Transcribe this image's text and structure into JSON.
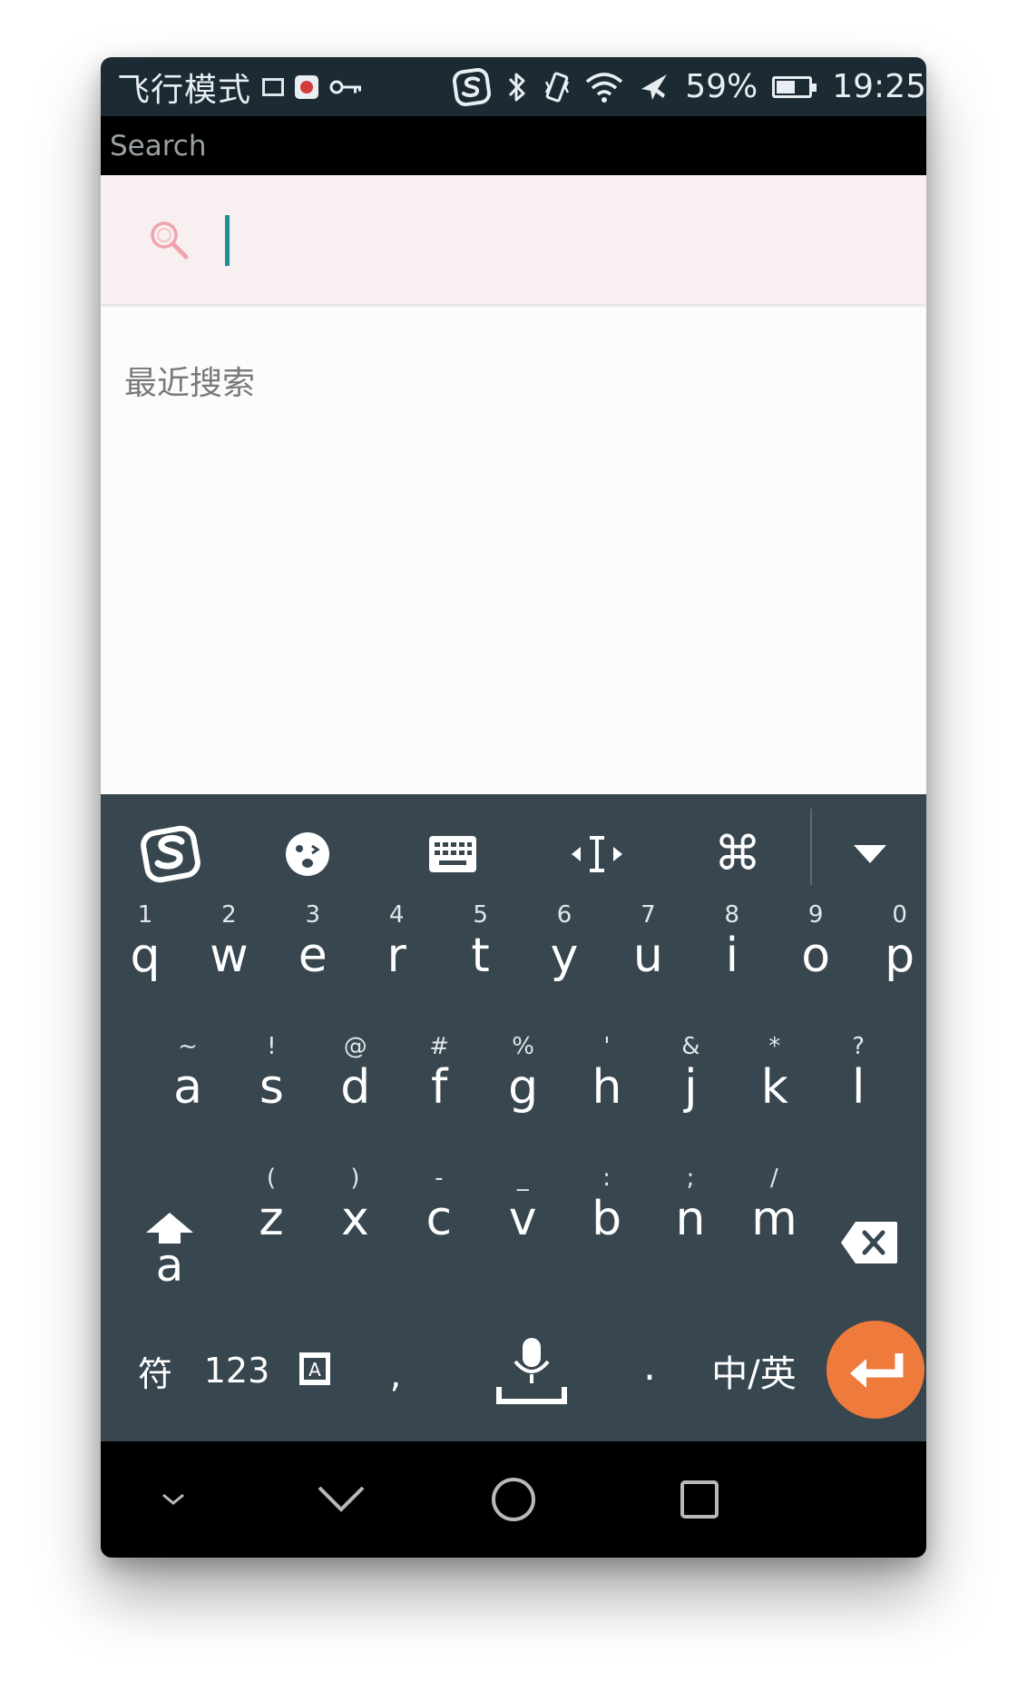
{
  "status_bar": {
    "carrier": "飞行模式",
    "battery_percent": "59%",
    "battery_level": 0.59,
    "time": "19:25",
    "icons": [
      "sim-icon",
      "screen-record-icon",
      "key-icon",
      "sogou-icon",
      "bluetooth-icon",
      "vibrate-icon",
      "wifi-icon",
      "airplane-icon",
      "battery-icon"
    ]
  },
  "title_bar": {
    "title": "Search"
  },
  "search": {
    "value": "",
    "placeholder": ""
  },
  "recent": {
    "title": "最近搜索"
  },
  "keyboard": {
    "toolbar": [
      "sogou-logo-icon",
      "emoji-icon",
      "keyboard-icon",
      "cursor-move-icon",
      "command-icon",
      "collapse-icon"
    ],
    "row1": [
      {
        "pri": "q",
        "sec": "1"
      },
      {
        "pri": "w",
        "sec": "2"
      },
      {
        "pri": "e",
        "sec": "3"
      },
      {
        "pri": "r",
        "sec": "4"
      },
      {
        "pri": "t",
        "sec": "5"
      },
      {
        "pri": "y",
        "sec": "6"
      },
      {
        "pri": "u",
        "sec": "7"
      },
      {
        "pri": "i",
        "sec": "8"
      },
      {
        "pri": "o",
        "sec": "9"
      },
      {
        "pri": "p",
        "sec": "0"
      }
    ],
    "row2": [
      {
        "pri": "a",
        "sec": "~"
      },
      {
        "pri": "s",
        "sec": "!"
      },
      {
        "pri": "d",
        "sec": "@"
      },
      {
        "pri": "f",
        "sec": "#"
      },
      {
        "pri": "g",
        "sec": "%"
      },
      {
        "pri": "h",
        "sec": "'"
      },
      {
        "pri": "j",
        "sec": "&"
      },
      {
        "pri": "k",
        "sec": "*"
      },
      {
        "pri": "l",
        "sec": "?"
      }
    ],
    "row3": [
      {
        "pri": "z",
        "sec": "("
      },
      {
        "pri": "x",
        "sec": ")"
      },
      {
        "pri": "c",
        "sec": "-"
      },
      {
        "pri": "v",
        "sec": "_"
      },
      {
        "pri": "b",
        "sec": ":"
      },
      {
        "pri": "n",
        "sec": ";"
      },
      {
        "pri": "m",
        "sec": "/"
      }
    ],
    "shift_label": "a",
    "symbols_label": "符",
    "numbers_label": "123",
    "comma_label": ",",
    "period_label": ".",
    "lang_label": "中/英",
    "accent_color": "#ee7a3c",
    "background_color": "#37464f"
  },
  "navigation": [
    "hide-keyboard-icon",
    "back-icon",
    "home-icon",
    "recents-icon"
  ]
}
